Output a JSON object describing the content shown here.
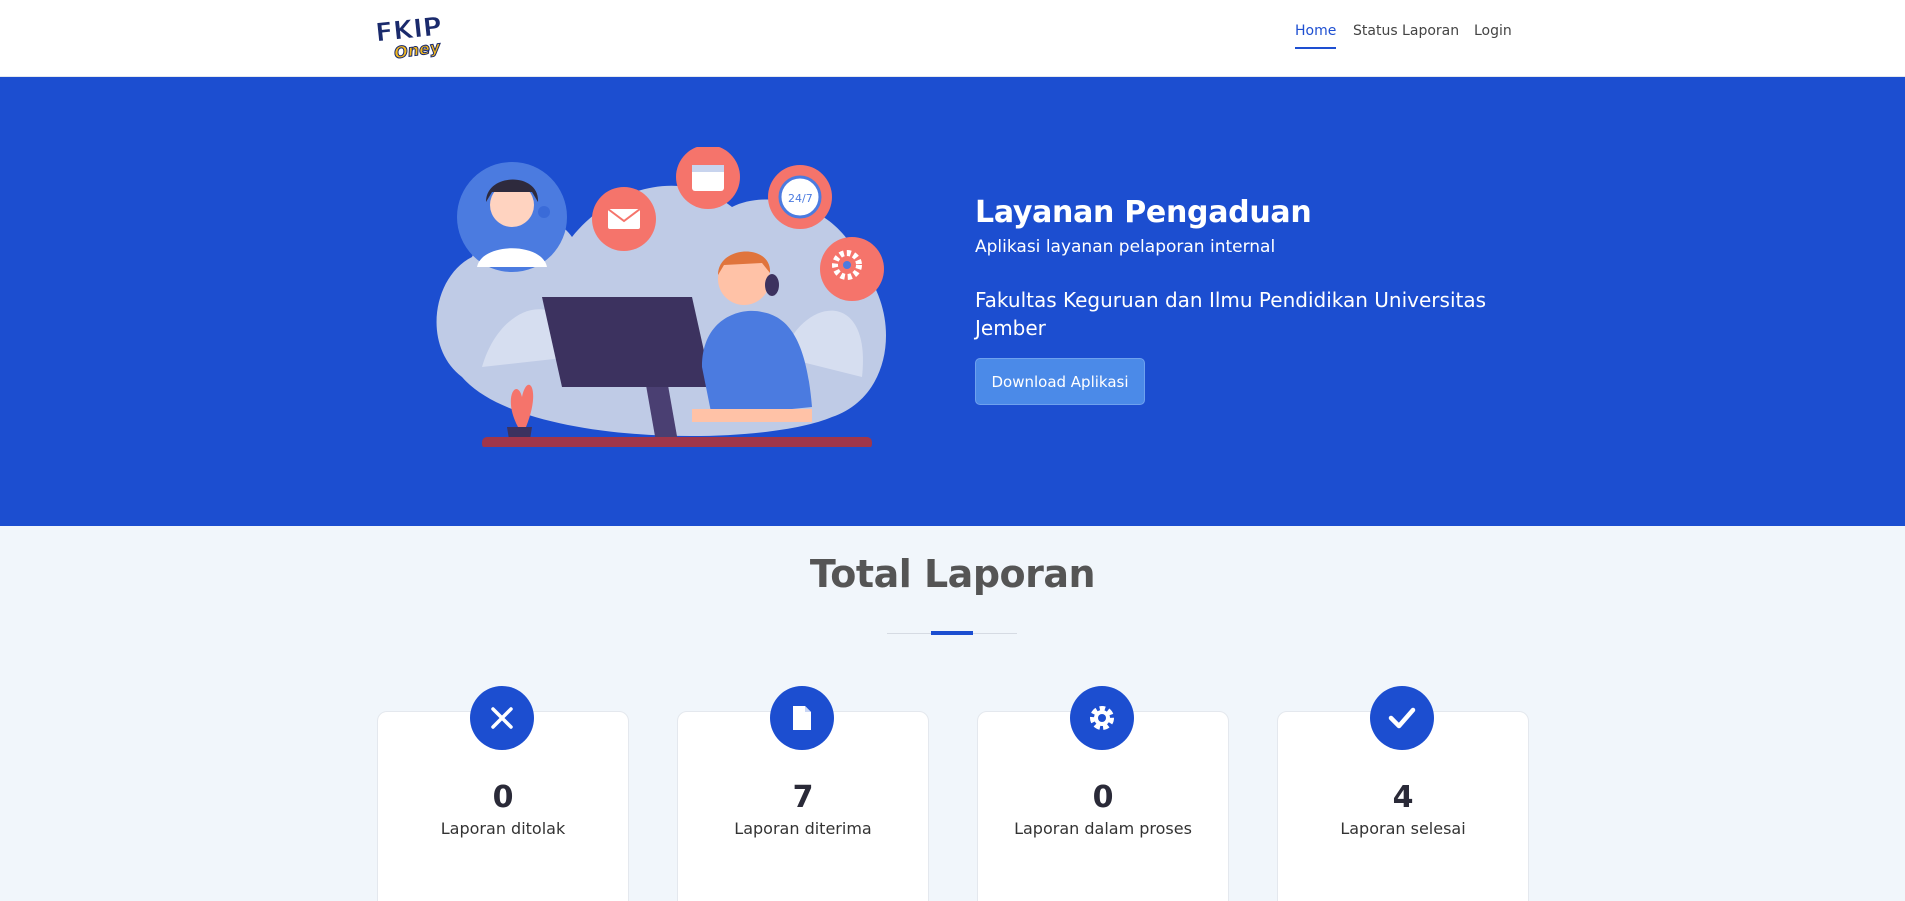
{
  "header": {
    "logo_text": "FKIP Oney",
    "nav": [
      {
        "label": "Home",
        "active": true
      },
      {
        "label": "Status Laporan",
        "active": false
      },
      {
        "label": "Login",
        "active": false
      }
    ]
  },
  "hero": {
    "title": "Layanan Pengaduan",
    "subtitle": "Aplikasi layanan pelaporan internal",
    "faculty": "Fakultas Keguruan dan Ilmu Pendidikan Universitas Jember",
    "button_label": "Download Aplikasi",
    "bg_color": "#1c4ed0"
  },
  "stats": {
    "title": "Total Laporan",
    "cards": [
      {
        "icon": "x-icon",
        "value": "0",
        "label": "Laporan ditolak"
      },
      {
        "icon": "file-icon",
        "value": "7",
        "label": "Laporan diterima"
      },
      {
        "icon": "gear-icon",
        "value": "0",
        "label": "Laporan dalam proses"
      },
      {
        "icon": "check-icon",
        "value": "4",
        "label": "Laporan selesai"
      }
    ]
  },
  "colors": {
    "accent": "#1c4ed0",
    "button": "#4b8ae8",
    "page_bg": "#f1f6fb"
  }
}
